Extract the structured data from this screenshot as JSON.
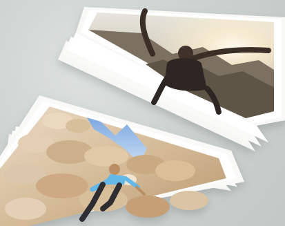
{
  "scene": {
    "background_color": "#cfd5d3",
    "description_hidden": ""
  },
  "cards": [
    {
      "name": "upper-card-stack",
      "photo_subject": "person-arms-raised-sunset",
      "sky_color": "#d9d7cc",
      "sun_color": "#fff6d8",
      "mountain_color": "#6e6555",
      "figure_color": "#3d3127"
    },
    {
      "name": "lower-card-stack",
      "photo_subject": "person-climbing-rocks",
      "sky_color": "#a9c7e8",
      "rock_color": "#d8c1a1",
      "shirt_color": "#62b6e6",
      "pants_color": "#2d2f33"
    }
  ]
}
